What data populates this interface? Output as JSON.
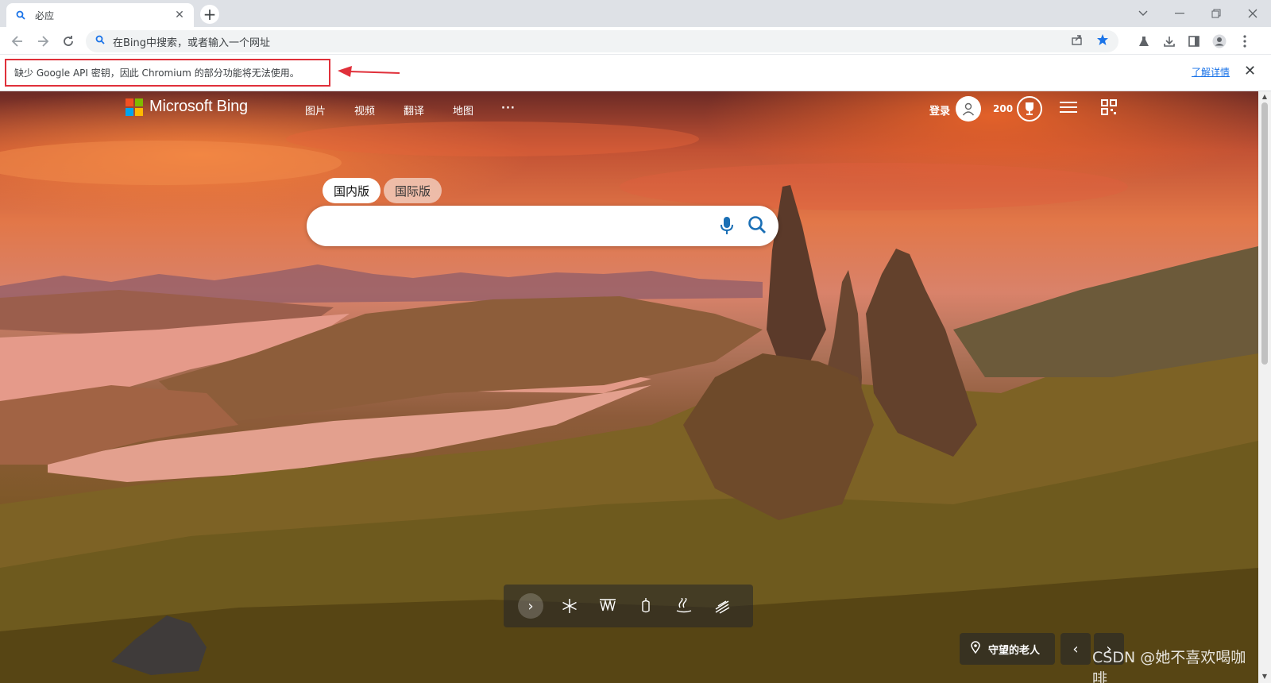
{
  "browser": {
    "tab_title": "必应",
    "tab_close": "✕",
    "new_tab": "+",
    "window_controls": [
      "chevron-down",
      "minimize",
      "restore",
      "close"
    ],
    "address_placeholder": "在Bing中搜索，或者输入一个网址"
  },
  "infobar": {
    "message": "缺少 Google API 密钥，因此 Chromium 的部分功能将无法使用。",
    "link": "了解详情",
    "highlight_color": "#e0303a"
  },
  "bing": {
    "brand": "Microsoft Bing",
    "nav": [
      "图片",
      "视频",
      "翻译",
      "地图",
      "···"
    ],
    "login": "登录",
    "points": "200",
    "scopes": [
      {
        "label": "国内版",
        "active": true
      },
      {
        "label": "国际版",
        "active": false
      }
    ],
    "search_placeholder": "",
    "location": "守望的老人",
    "watermark": "CSDN @她不喜欢喝咖啡",
    "logo_colors": [
      "#f25022",
      "#7fba00",
      "#00a4ef",
      "#ffb900"
    ]
  }
}
